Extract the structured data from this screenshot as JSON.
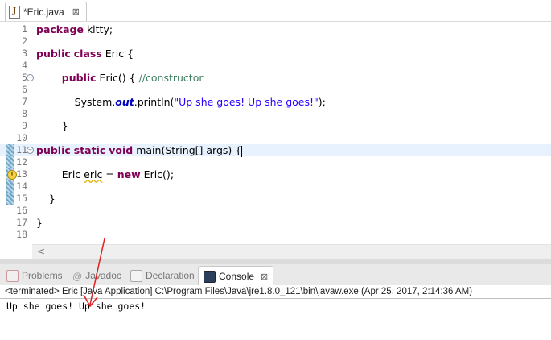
{
  "editor_tab": {
    "label": "*Eric.java",
    "close": "⊠"
  },
  "code_lines": [
    {
      "num": "1",
      "html": "<span class=\"kw\">package</span> kitty;"
    },
    {
      "num": "2",
      "html": ""
    },
    {
      "num": "3",
      "html": "<span class=\"kw\">public</span> <span class=\"kw\">class</span> Eric {"
    },
    {
      "num": "4",
      "html": ""
    },
    {
      "num": "5",
      "html": "        <span class=\"kw\">public</span> Eric() { <span class=\"cmt\">//constructor</span>",
      "fold": true
    },
    {
      "num": "6",
      "html": ""
    },
    {
      "num": "7",
      "html": "            System.<span class=\"fld\">out</span>.println(<span class=\"str\">\"Up she goes! Up she goes!\"</span>);"
    },
    {
      "num": "8",
      "html": ""
    },
    {
      "num": "9",
      "html": "        }"
    },
    {
      "num": "10",
      "html": ""
    },
    {
      "num": "11",
      "html": "<span class=\"kw\">public</span> <span class=\"kw\">static</span> <span class=\"kw\">void</span> main(String[] args) {<span class=\"caret\"></span>",
      "fold": true,
      "marker": true,
      "highlight": true
    },
    {
      "num": "12",
      "html": "",
      "marker": true
    },
    {
      "num": "13",
      "html": "        Eric <span class=\"warn\">eric</span> = <span class=\"kw\">new</span> Eric();",
      "marker": true,
      "warn": true
    },
    {
      "num": "14",
      "html": "",
      "marker": true
    },
    {
      "num": "15",
      "html": "    }",
      "marker": true
    },
    {
      "num": "16",
      "html": ""
    },
    {
      "num": "17",
      "html": "}"
    },
    {
      "num": "18",
      "html": ""
    }
  ],
  "hscroll": {
    "left_arrow": "<"
  },
  "panel_tabs": [
    {
      "label": "Problems",
      "icon": "problems-icon"
    },
    {
      "label": "Javadoc",
      "icon": "javadoc-icon"
    },
    {
      "label": "Declaration",
      "icon": "declaration-icon"
    },
    {
      "label": "Console",
      "icon": "console-icon",
      "close": "⊠"
    }
  ],
  "console": {
    "header": "<terminated> Eric [Java Application] C:\\Program Files\\Java\\jre1.8.0_121\\bin\\javaw.exe (Apr 25, 2017, 2:14:36 AM)",
    "output": "Up she goes! Up she goes!"
  },
  "colors": {
    "keyword": "#7f0055",
    "string": "#2a00ff",
    "comment": "#3f7f5f",
    "annotation_arrow": "#e02020"
  }
}
